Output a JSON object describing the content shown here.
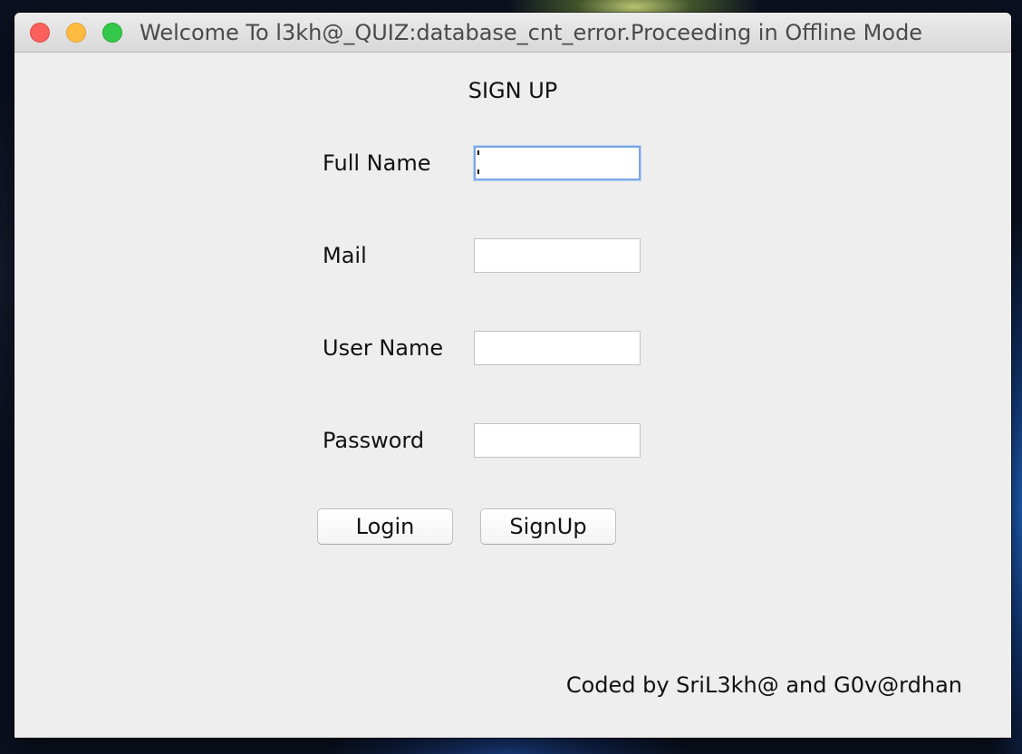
{
  "window": {
    "title": "Welcome To l3kh@_QUIZ:database_cnt_error.Proceeding in Offline Mode"
  },
  "form": {
    "heading": "SIGN UP",
    "fields": [
      {
        "label": "Full Name",
        "value": ""
      },
      {
        "label": "Mail",
        "value": ""
      },
      {
        "label": "User Name",
        "value": ""
      },
      {
        "label": "Password",
        "value": ""
      }
    ],
    "login_label": "Login",
    "signup_label": "SignUp"
  },
  "footer": {
    "credit": "Coded by SriL3kh@ and G0v@rdhan"
  }
}
